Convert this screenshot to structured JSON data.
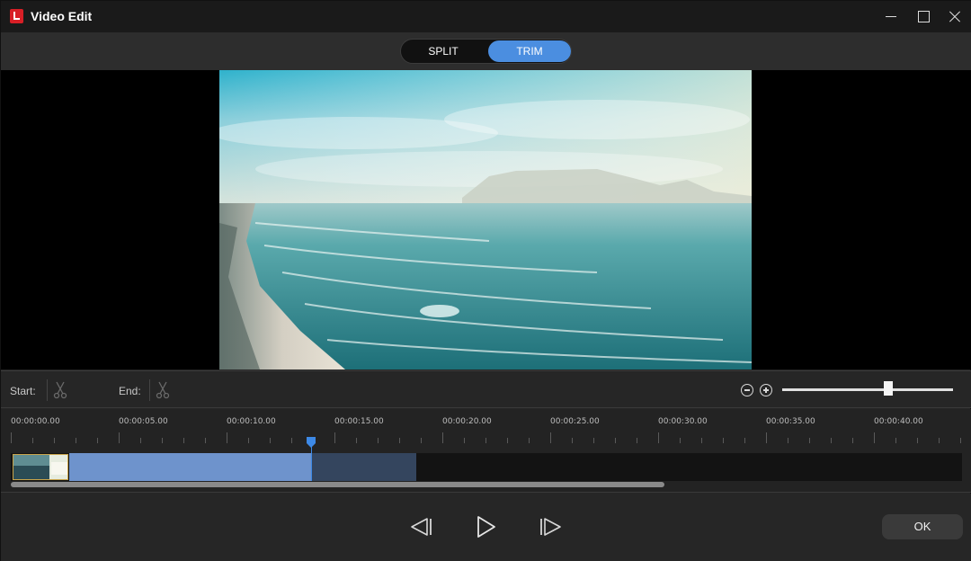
{
  "window": {
    "title": "Video Edit"
  },
  "modes": {
    "split": "SPLIT",
    "trim": "TRIM",
    "active": "TRIM"
  },
  "cut": {
    "start_label": "Start:",
    "end_label": "End:"
  },
  "zoom": {
    "level": 0.62
  },
  "timeline": {
    "ruler": [
      "00:00:00.00",
      "00:00:05.00",
      "00:00:10.00",
      "00:00:15.00",
      "00:00:20.00",
      "00:00:25.00",
      "00:00:30.00",
      "00:00:35.00",
      "00:00:40.00"
    ]
  },
  "actions": {
    "ok": "OK"
  },
  "colors": {
    "accent": "#4b8ee0",
    "selection": "#6e93cc",
    "selection_dark": "#34455e",
    "playhead": "#3d89e6",
    "logo": "#d81f26"
  },
  "icons": [
    "app-logo-icon",
    "minimize-icon",
    "maximize-icon",
    "close-icon",
    "scissors-icon",
    "zoom-out-icon",
    "zoom-in-icon",
    "previous-frame-icon",
    "play-icon",
    "next-frame-icon"
  ]
}
